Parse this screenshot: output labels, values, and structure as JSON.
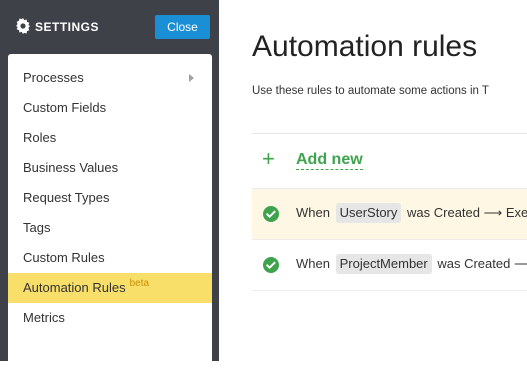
{
  "sidebar": {
    "title": "SETTINGS",
    "close_label": "Close",
    "items": [
      {
        "label": "Processes"
      },
      {
        "label": "Custom Fields"
      },
      {
        "label": "Roles"
      },
      {
        "label": "Business Values"
      },
      {
        "label": "Request Types"
      },
      {
        "label": "Tags"
      },
      {
        "label": "Custom Rules"
      },
      {
        "label": "Automation Rules",
        "badge": "beta"
      },
      {
        "label": "Metrics"
      }
    ]
  },
  "main": {
    "title": "Automation rules",
    "description": "Use these rules to automate some actions in T",
    "add_label": "Add new",
    "rules": [
      {
        "when": "When",
        "entity": "UserStory",
        "rest": "was Created ⟶ Exec"
      },
      {
        "when": "When",
        "entity": "ProjectMember",
        "rest": "was Created ⟶"
      }
    ]
  },
  "colors": {
    "sidebar_bg": "#3e4148",
    "accent_blue": "#1a8fd6",
    "active_item": "#f7df6a",
    "green": "#3fa34d"
  }
}
